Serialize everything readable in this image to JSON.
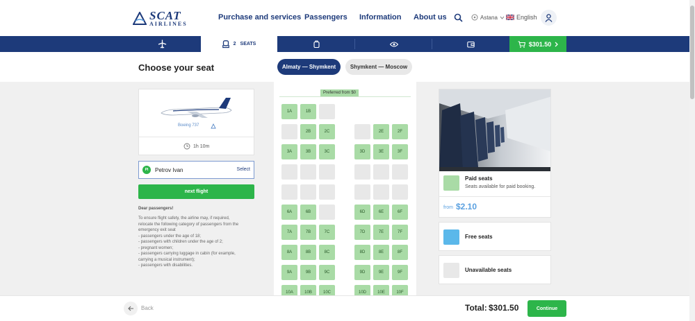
{
  "header": {
    "logo_main": "SCAT",
    "logo_sub": "AIRLINES",
    "nav": [
      "Purchase and services",
      "Passengers",
      "Information",
      "About us"
    ],
    "location": "Astana",
    "language": "English"
  },
  "steps": {
    "seats_count": "2",
    "seats_label": "SEATS",
    "cart_total": "$301.50"
  },
  "page": {
    "title": "Choose your seat",
    "routes": [
      "Almaty — Shymkent",
      "Shymkent — Moscow"
    ],
    "active_route_index": 0
  },
  "flight": {
    "aircraft": "Boeing 737",
    "duration": "1h 10m"
  },
  "passenger": {
    "initials": "PI",
    "name": "Petrov Ivan",
    "select_label": "Select"
  },
  "next_flight_label": "next flight",
  "notice": {
    "title": "Dear passengers!",
    "lines": [
      "To ensure flight safety, the airline may, if required,",
      "relocate the following category of passengers from the",
      "emergency exit seat",
      "- passengers under the age of 18;",
      "- passengers with children under the age of 2;",
      "- pregnant women;",
      "- passengers carrying luggage in cabin (for example,",
      "carrying a musical instrument);",
      "- passengers with disabilities."
    ]
  },
  "seatmap": {
    "preferred_label": "Preferred  from $0",
    "rows": [
      [
        "1A",
        "1B",
        "",
        null,
        null,
        null
      ],
      [
        "",
        "2B",
        "2C",
        "",
        "2E",
        "2F"
      ],
      [
        "3A",
        "3B",
        "3C",
        "3D",
        "3E",
        "3F"
      ],
      [
        "",
        "",
        "",
        "",
        "",
        ""
      ],
      [
        "",
        "",
        "",
        "",
        "",
        ""
      ],
      [
        "6A",
        "6B",
        "",
        "6D",
        "6E",
        "6F"
      ],
      [
        "7A",
        "7B",
        "7C",
        "7D",
        "7E",
        "7F"
      ],
      [
        "8A",
        "8B",
        "8C",
        "8D",
        "8E",
        "8F"
      ],
      [
        "9A",
        "9B",
        "9C",
        "9D",
        "9E",
        "9F"
      ],
      [
        "10A",
        "10B",
        "10C",
        "10D",
        "10E",
        "10F"
      ]
    ]
  },
  "legend": {
    "paid_title": "Paid seats",
    "paid_desc": "Seats available for paid booking.",
    "price_from": "from",
    "price": "$2.10",
    "free_title": "Free seats",
    "unavailable_title": "Unavailable seats",
    "colors": {
      "paid": "#a9dba6",
      "free": "#5bb8ea",
      "unavailable": "#e8e8e8"
    }
  },
  "footer": {
    "back_label": "Back",
    "total_label": "Total:",
    "total_value": "$301.50",
    "continue_label": "Continue"
  },
  "colors": {
    "brand": "#1d3a7a",
    "accent": "#2db54a"
  }
}
